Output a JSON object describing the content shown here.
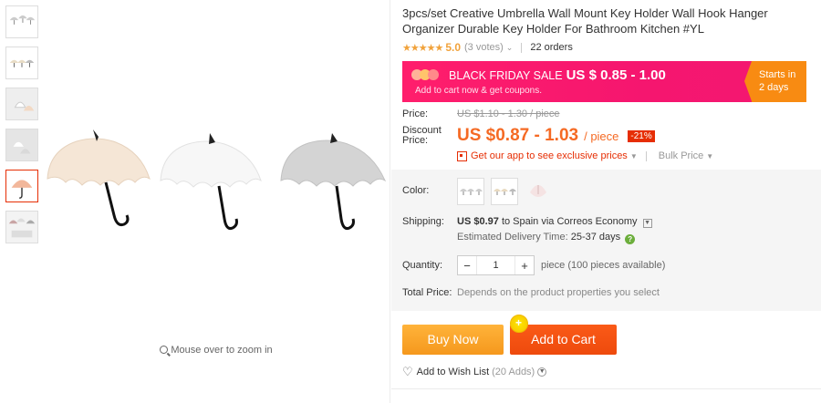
{
  "gallery": {
    "zoom_hint": "Mouse over to zoom in",
    "thumbnail_count": 6
  },
  "product": {
    "title": "3pcs/set Creative Umbrella Wall Mount Key Holder Wall Hook Hanger Organizer Durable Key Holder For Bathroom Kitchen #YL",
    "stars": "★★★★★",
    "rating": "5.0",
    "votes": "(3 votes)",
    "orders": "22 orders"
  },
  "promo": {
    "label": "BLACK FRIDAY SALE",
    "price": "US $ 0.85 - 1.00",
    "subtitle": "Add to cart now & get coupons.",
    "starts_label": "Starts in",
    "starts_value": "2 days",
    "color": "#f5166f",
    "starts_color": "#f88b12"
  },
  "pricing": {
    "price_label": "Price:",
    "original_price": "US $1.10 - 1.30 / piece",
    "discount_label_1": "Discount",
    "discount_label_2": "Price:",
    "discount_price": "US $0.87 - 1.03",
    "per_piece": "/ piece",
    "discount_badge": "-21%",
    "app_link": "Get our app to see exclusive prices",
    "bulk_price": "Bulk Price"
  },
  "options": {
    "color_label": "Color:",
    "shipping_label": "Shipping:",
    "shipping_price": "US $0.97",
    "shipping_dest": "to Spain via Correos Economy",
    "delivery_label": "Estimated Delivery Time:",
    "delivery_value": "25-37 days",
    "quantity_label": "Quantity:",
    "quantity_minus": "−",
    "quantity_value": "1",
    "quantity_plus": "+",
    "quantity_note": "piece (100 pieces available)",
    "total_label": "Total Price:",
    "total_value": "Depends on the product properties you select"
  },
  "actions": {
    "buy_now": "Buy Now",
    "add_to_cart": "Add to Cart",
    "wishlist": "Add to Wish List",
    "wishlist_count": "(20 Adds)",
    "buy_color": "#f5a623",
    "cart_color": "#f2520f"
  }
}
